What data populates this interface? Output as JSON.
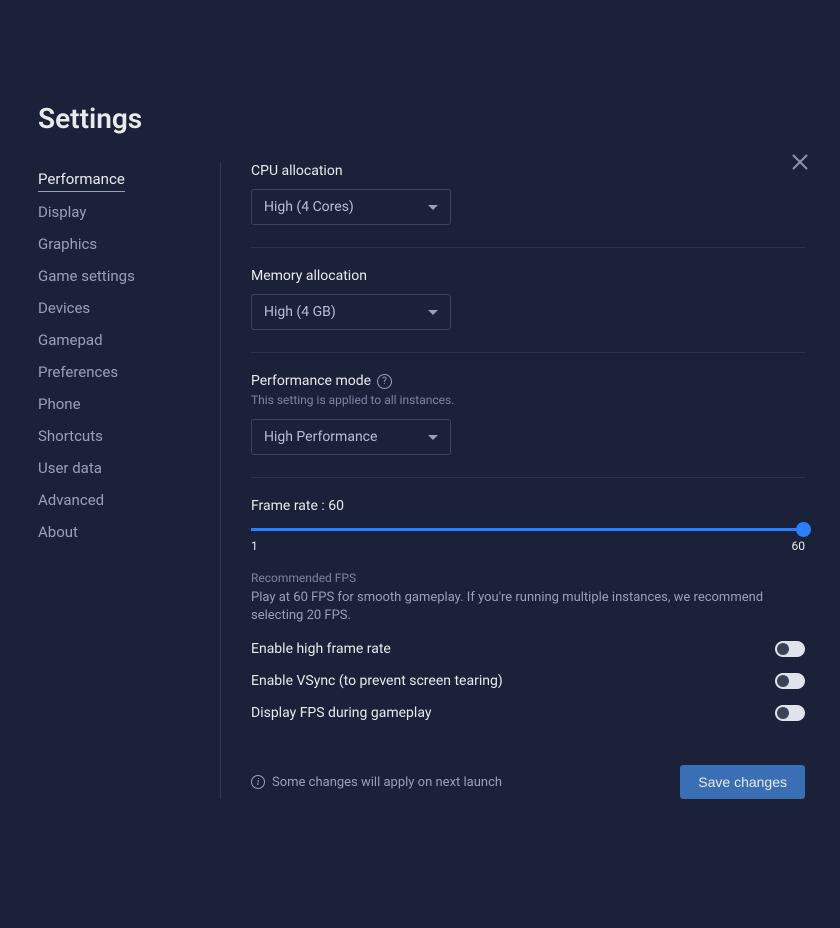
{
  "title": "Settings",
  "sidebar": {
    "items": [
      {
        "label": "Performance",
        "active": true
      },
      {
        "label": "Display",
        "active": false
      },
      {
        "label": "Graphics",
        "active": false
      },
      {
        "label": "Game settings",
        "active": false
      },
      {
        "label": "Devices",
        "active": false
      },
      {
        "label": "Gamepad",
        "active": false
      },
      {
        "label": "Preferences",
        "active": false
      },
      {
        "label": "Phone",
        "active": false
      },
      {
        "label": "Shortcuts",
        "active": false
      },
      {
        "label": "User data",
        "active": false
      },
      {
        "label": "Advanced",
        "active": false
      },
      {
        "label": "About",
        "active": false
      }
    ]
  },
  "fields": {
    "cpu": {
      "label": "CPU allocation",
      "value": "High (4 Cores)"
    },
    "memory": {
      "label": "Memory allocation",
      "value": "High (4 GB)"
    },
    "perfmode": {
      "label": "Performance mode",
      "hint": "This setting is applied to all instances.",
      "value": "High Performance"
    },
    "framerate": {
      "label": "Frame rate : 60",
      "min": "1",
      "max": "60",
      "value": 60
    },
    "recommended": {
      "title": "Recommended FPS",
      "desc": "Play at 60 FPS for smooth gameplay. If you're running multiple instances, we recommend selecting 20 FPS."
    },
    "toggles": {
      "highframe": "Enable high frame rate",
      "vsync": "Enable VSync (to prevent screen tearing)",
      "displayfps": "Display FPS during gameplay"
    }
  },
  "footer": {
    "note": "Some changes will apply on next launch",
    "save": "Save changes"
  }
}
